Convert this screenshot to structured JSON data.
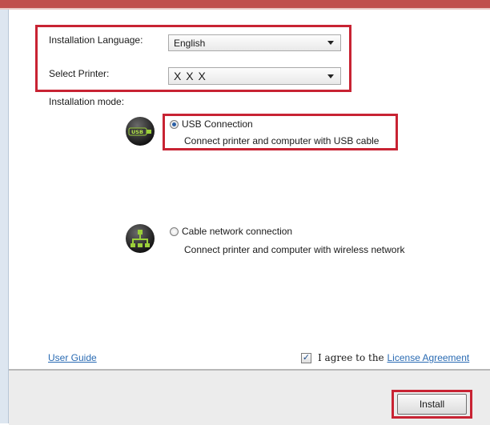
{
  "form": {
    "language_label": "Installation Language:",
    "language_value": "English",
    "printer_label": "Select Printer:",
    "printer_value": "X X X",
    "mode_label": "Installation mode:"
  },
  "modes": [
    {
      "title": "USB Connection",
      "description": "Connect printer and computer with USB cable",
      "selected": true,
      "icon": "usb-icon"
    },
    {
      "title": "Cable network connection",
      "description": "Connect printer and computer with wireless network",
      "selected": false,
      "icon": "network-icon"
    }
  ],
  "footer": {
    "user_guide": "User Guide",
    "agree_text": "I agree to the",
    "license_link": "License Agreement",
    "agree_checked": true,
    "install_label": "Install"
  },
  "colors": {
    "highlight": "#c82333",
    "link": "#2a6bb3",
    "title_bar": "#c0504d"
  }
}
